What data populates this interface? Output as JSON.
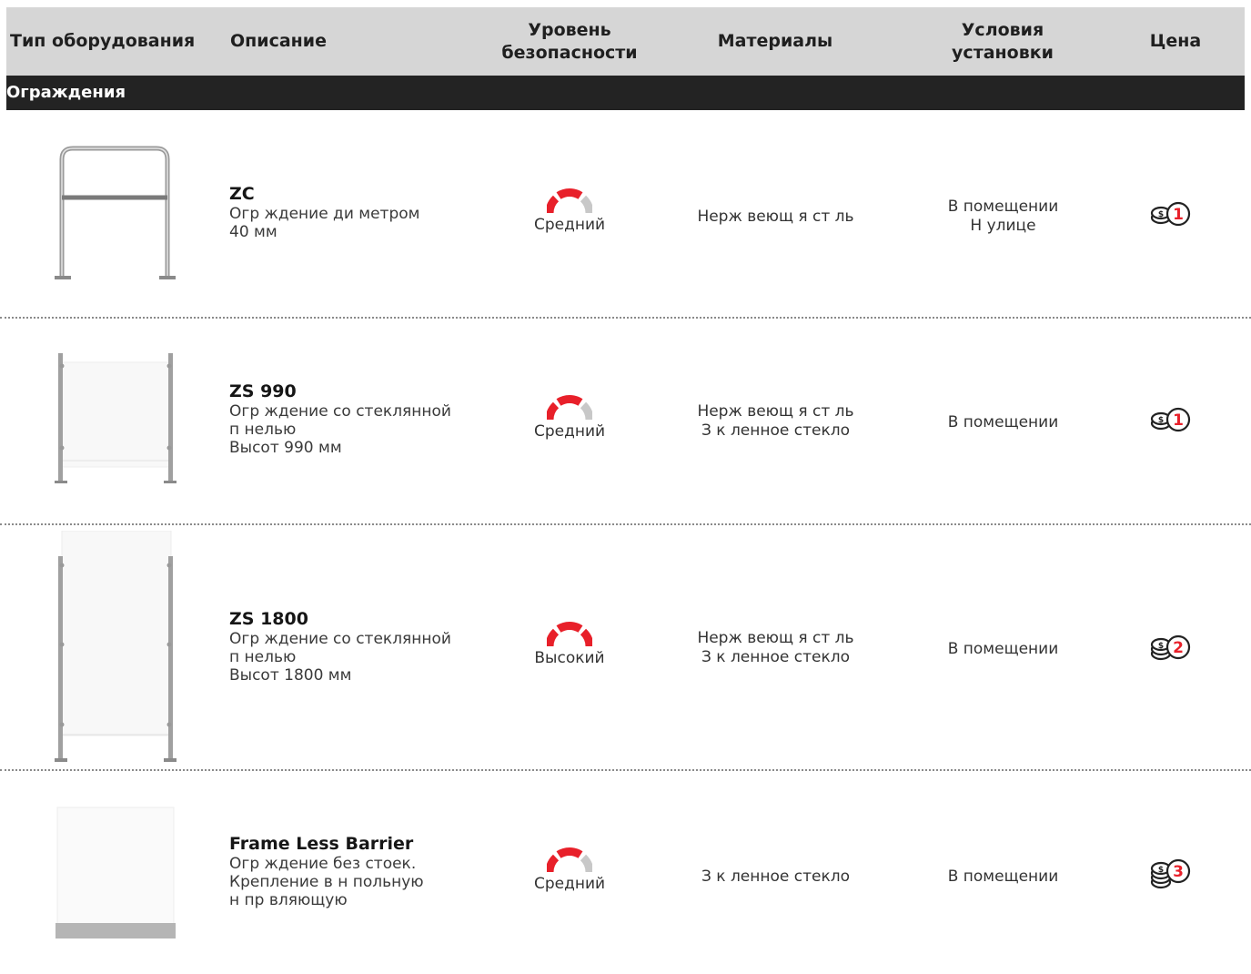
{
  "header": {
    "type": "Тип оборудования",
    "description": "Описание",
    "security": "Уровень безопасности",
    "materials": "Материалы",
    "conditions": "Условия установки",
    "price": "Цена"
  },
  "section": {
    "title": "Ограждения"
  },
  "colors": {
    "accent": "#e8202a",
    "header_bg": "#d6d6d6",
    "section_bg": "#232323",
    "gauge_track": "#c8c8c8"
  },
  "rows": [
    {
      "title": "ZC",
      "desc": [
        "Огр ждение ди метром",
        "40 мм"
      ],
      "security_label": "Средний",
      "security_level": 2,
      "materials": [
        "Нерж веющ я ст ль"
      ],
      "conditions": [
        "В помещении",
        "Н улице"
      ],
      "price_level": "1",
      "price_icon": "coins-icon"
    },
    {
      "title": "ZS 990",
      "desc": [
        "Огр ждение со стеклянной",
        "п нелью",
        "Высот 990 мм"
      ],
      "security_label": "Средний",
      "security_level": 2,
      "materials": [
        "Нерж веющ я ст ль",
        "З к ленное стекло"
      ],
      "conditions": [
        "В помещении"
      ],
      "price_level": "1",
      "price_icon": "coins-icon"
    },
    {
      "title": "ZS 1800",
      "desc": [
        "Огр ждение со стеклянной",
        "п нелью",
        "Высот 1800 мм"
      ],
      "security_label": "Высокий",
      "security_level": 3,
      "materials": [
        "Нерж веющ я ст ль",
        "З к ленное стекло"
      ],
      "conditions": [
        "В помещении"
      ],
      "price_level": "2",
      "price_icon": "coins-icon"
    },
    {
      "title": "Frame Less Barrier",
      "desc": [
        "Огр ждение без стоек.",
        "Крепление в н польную",
        "н пр вляющую"
      ],
      "security_label": "Средний",
      "security_level": 2,
      "materials": [
        "З к ленное стекло"
      ],
      "conditions": [
        "В помещении"
      ],
      "price_level": "3",
      "price_icon": "coins-icon"
    }
  ]
}
